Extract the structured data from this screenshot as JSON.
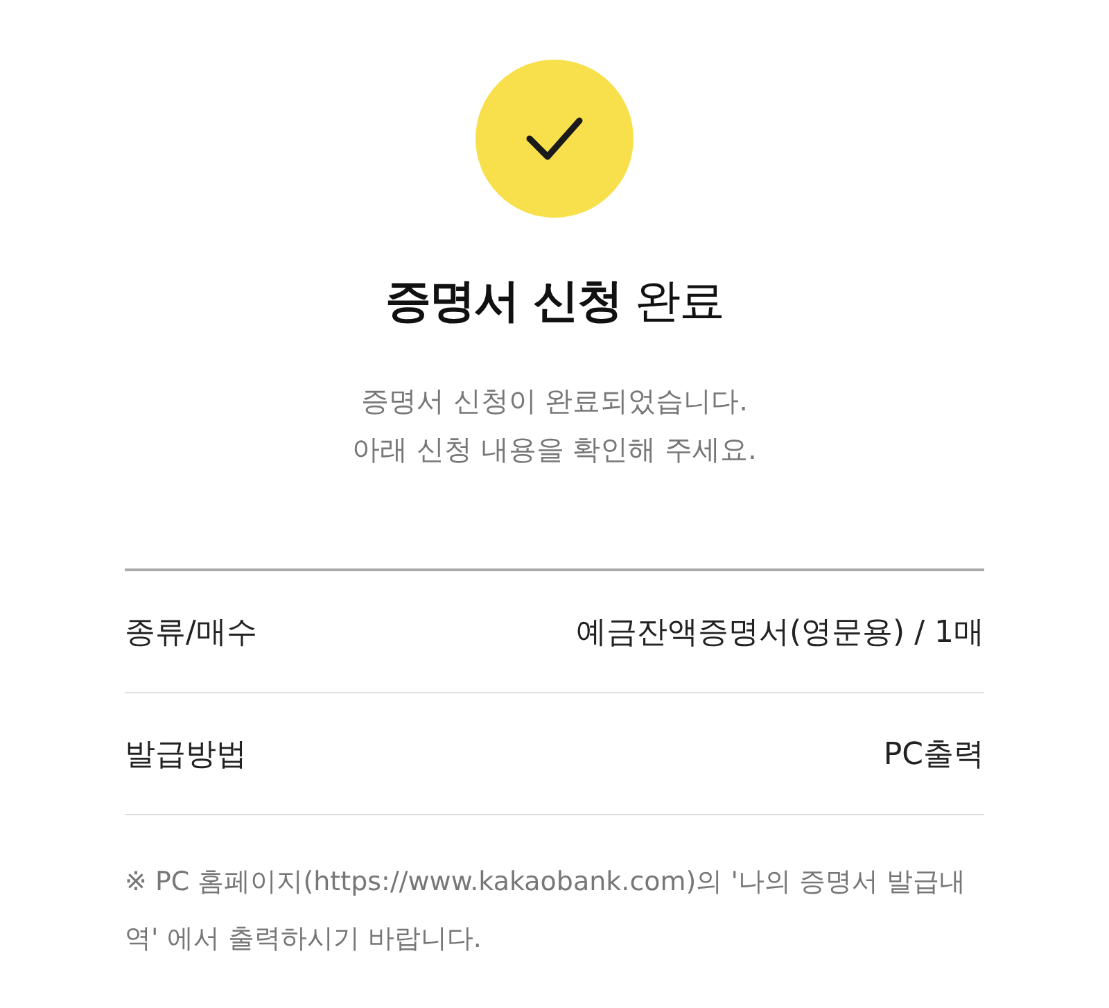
{
  "title": "**증명서 신청** 완료",
  "message": [
    "증명서 신청이 완료되었습니다.",
    "아래 신청 내용을 확인해 주세요."
  ],
  "details": [
    {
      "label": "종류/매수",
      "value": "예금잔액증명서(영문용) / 1매"
    },
    {
      "label": "발급방법",
      "value": "PC출력"
    }
  ],
  "note": "※ PC 홈페이지(https://www.kakaobank.com)의 '나의 증명서 발급내역' 에서 출력하시기 바랍니다."
}
